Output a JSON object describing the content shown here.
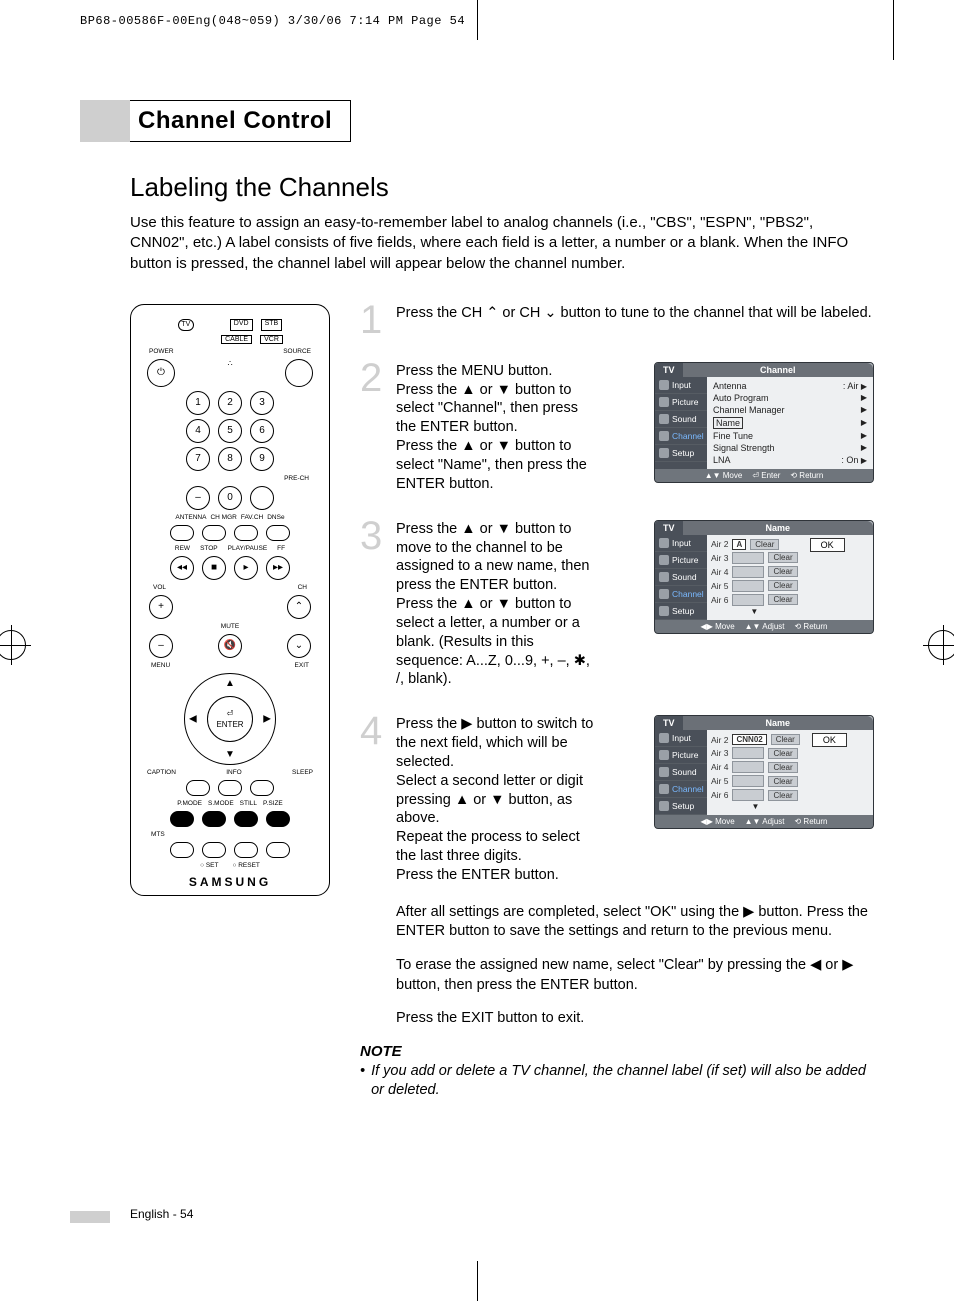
{
  "slugline": "BP68-00586F-00Eng(048~059)  3/30/06  7:14 PM  Page 54",
  "section_title": "Channel Control",
  "subhead": "Labeling the Channels",
  "intro": "Use this feature to assign an easy-to-remember label to analog channels (i.e., \"CBS\", \"ESPN\", \"PBS2\", CNN02\", etc.) A label consists of five fields, where each field is a letter, a number or a blank. When the INFO button is pressed, the channel label will appear below the channel number.",
  "remote": {
    "mode_labels": [
      "DVD",
      "STB",
      "CABLE",
      "VCR"
    ],
    "tv_label": "TV",
    "power": "POWER",
    "source": "SOURCE",
    "digits": [
      "1",
      "2",
      "3",
      "4",
      "5",
      "6",
      "7",
      "8",
      "9",
      "0"
    ],
    "dash": "–",
    "prech": "PRE-CH",
    "row_labels": [
      "ANTENNA",
      "CH MGR",
      "FAV.CH",
      "DNSe"
    ],
    "transport": [
      "REW",
      "STOP",
      "PLAY/PAUSE",
      "FF"
    ],
    "vol": "VOL",
    "ch": "CH",
    "mute": "MUTE",
    "menu": "MENU",
    "exit": "EXIT",
    "enter": "ENTER",
    "caption": "CAPTION",
    "info": "INFO",
    "sleep": "SLEEP",
    "modes": [
      "P.MODE",
      "S.MODE",
      "STILL",
      "P.SIZE"
    ],
    "mts": "MTS",
    "set": "SET",
    "reset": "RESET",
    "brand": "SAMSUNG"
  },
  "steps": [
    {
      "num": "1",
      "text": "Press the CH ⌃ or CH ⌄ button to tune to the channel that will be labeled."
    },
    {
      "num": "2",
      "text": "Press the MENU button.\nPress the ▲ or ▼ button to select \"Channel\", then press the ENTER button.\nPress the ▲ or ▼ button to select \"Name\", then press the ENTER button.",
      "osd": {
        "title": "Channel",
        "side": [
          "Input",
          "Picture",
          "Sound",
          "Channel",
          "Setup"
        ],
        "active_side": "Channel",
        "lines": [
          {
            "label": "Antenna",
            "value": ": Air"
          },
          {
            "label": "Auto Program",
            "value": ""
          },
          {
            "label": "Channel Manager",
            "value": ""
          },
          {
            "label": "Name",
            "value": "",
            "boxed": true
          },
          {
            "label": "Fine Tune",
            "value": ""
          },
          {
            "label": "Signal Strength",
            "value": ""
          },
          {
            "label": "LNA",
            "value": ": On"
          }
        ],
        "foot": [
          "▲▼ Move",
          "⏎ Enter",
          "⟲ Return"
        ]
      }
    },
    {
      "num": "3",
      "text": "Press the ▲ or ▼ button to move to the channel to be assigned to a new name, then press the ENTER button.\nPress the ▲ or ▼ button to select a letter, a number or a blank. (Results in this sequence: A...Z, 0...9, +, –, ✱, /, blank).",
      "osd": {
        "title": "Name",
        "side": [
          "Input",
          "Picture",
          "Sound",
          "Channel",
          "Setup"
        ],
        "active_side": "Channel",
        "rows": [
          {
            "ch": "Air  2",
            "sel": "A",
            "clear": "Clear"
          },
          {
            "ch": "Air  3",
            "sel": "-----",
            "clear": "Clear"
          },
          {
            "ch": "Air  4",
            "sel": "-----",
            "clear": "Clear"
          },
          {
            "ch": "Air  5",
            "sel": "-----",
            "clear": "Clear"
          },
          {
            "ch": "Air  6",
            "sel": "-----",
            "clear": "Clear"
          }
        ],
        "ok": "OK",
        "foot": [
          "◀▶ Move",
          "▲▼ Adjust",
          "⟲ Return"
        ]
      }
    },
    {
      "num": "4",
      "text": "Press the ▶ button to switch to the next field, which will be selected.\nSelect a second letter or digit pressing ▲ or ▼ button, as above.\nRepeat the process to select the last three digits.\nPress the ENTER button.",
      "osd": {
        "title": "Name",
        "side": [
          "Input",
          "Picture",
          "Sound",
          "Channel",
          "Setup"
        ],
        "active_side": "Channel",
        "rows": [
          {
            "ch": "Air  2",
            "sel": "CNN02",
            "clear": "Clear"
          },
          {
            "ch": "Air  3",
            "sel": "-----",
            "clear": "Clear"
          },
          {
            "ch": "Air  4",
            "sel": "-----",
            "clear": "Clear"
          },
          {
            "ch": "Air  5",
            "sel": "-----",
            "clear": "Clear"
          },
          {
            "ch": "Air  6",
            "sel": "-----",
            "clear": "Clear"
          }
        ],
        "ok": "OK",
        "foot": [
          "◀▶ Move",
          "▲▼ Adjust",
          "⟲ Return"
        ]
      }
    }
  ],
  "after": [
    "After all settings are completed, select \"OK\" using the ▶ button. Press the ENTER button to save the settings and return to the previous menu.",
    "To erase the assigned new name, select \"Clear\" by pressing the ◀ or ▶ button, then press the ENTER button.",
    "Press the EXIT button to exit."
  ],
  "note_head": "NOTE",
  "note_bullet": "•",
  "note_body": "If you add or delete a TV channel, the channel label (if set) will also be added or deleted.",
  "folio": "English - 54"
}
